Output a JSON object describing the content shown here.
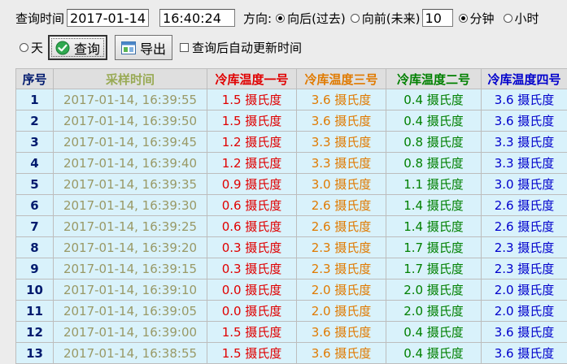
{
  "query_bar": {
    "query_time_label": "查询时间",
    "date_value": "2017-01-14",
    "time_value": "16:40:24",
    "direction_label": "方向:",
    "direction_options": [
      "向后(过去)",
      "向前(未来)"
    ],
    "direction_selected": 0,
    "amount_value": "10",
    "unit_options": [
      "分钟",
      "小时",
      "天"
    ],
    "unit_selected": 0,
    "query_button": "查询",
    "export_button": "导出",
    "auto_update_label": "查询后自动更新时间"
  },
  "table": {
    "headers": [
      "序号",
      "采样时间",
      "冷库温度一号",
      "冷库温度三号",
      "冷库温度二号",
      "冷库温度四号"
    ],
    "rows": [
      [
        "1",
        "2017-01-14, 16:39:55",
        "1.5 摄氏度",
        "3.6 摄氏度",
        "0.4 摄氏度",
        "3.6 摄氏度"
      ],
      [
        "2",
        "2017-01-14, 16:39:50",
        "1.5 摄氏度",
        "3.6 摄氏度",
        "0.4 摄氏度",
        "3.6 摄氏度"
      ],
      [
        "3",
        "2017-01-14, 16:39:45",
        "1.2 摄氏度",
        "3.3 摄氏度",
        "0.8 摄氏度",
        "3.3 摄氏度"
      ],
      [
        "4",
        "2017-01-14, 16:39:40",
        "1.2 摄氏度",
        "3.3 摄氏度",
        "0.8 摄氏度",
        "3.3 摄氏度"
      ],
      [
        "5",
        "2017-01-14, 16:39:35",
        "0.9 摄氏度",
        "3.0 摄氏度",
        "1.1 摄氏度",
        "3.0 摄氏度"
      ],
      [
        "6",
        "2017-01-14, 16:39:30",
        "0.6 摄氏度",
        "2.6 摄氏度",
        "1.4 摄氏度",
        "2.6 摄氏度"
      ],
      [
        "7",
        "2017-01-14, 16:39:25",
        "0.6 摄氏度",
        "2.6 摄氏度",
        "1.4 摄氏度",
        "2.6 摄氏度"
      ],
      [
        "8",
        "2017-01-14, 16:39:20",
        "0.3 摄氏度",
        "2.3 摄氏度",
        "1.7 摄氏度",
        "2.3 摄氏度"
      ],
      [
        "9",
        "2017-01-14, 16:39:15",
        "0.3 摄氏度",
        "2.3 摄氏度",
        "1.7 摄氏度",
        "2.3 摄氏度"
      ],
      [
        "10",
        "2017-01-14, 16:39:10",
        "0.0 摄氏度",
        "2.0 摄氏度",
        "2.0 摄氏度",
        "2.0 摄氏度"
      ],
      [
        "11",
        "2017-01-14, 16:39:05",
        "0.0 摄氏度",
        "2.0 摄氏度",
        "2.0 摄氏度",
        "2.0 摄氏度"
      ],
      [
        "12",
        "2017-01-14, 16:39:00",
        "1.5 摄氏度",
        "3.6 摄氏度",
        "0.4 摄氏度",
        "3.6 摄氏度"
      ],
      [
        "13",
        "2017-01-14, 16:38:55",
        "1.5 摄氏度",
        "3.6 摄氏度",
        "0.4 摄氏度",
        "3.6 摄氏度"
      ]
    ]
  },
  "colors": {
    "sensor_1": "#e00000",
    "sensor_3": "#e07a00",
    "sensor_2": "#008000",
    "sensor_4": "#0000cc",
    "row_background": "#d9f2fb"
  },
  "icons": {
    "query_button_icon": "green-check-icon",
    "export_button_icon": "spreadsheet-icon"
  }
}
